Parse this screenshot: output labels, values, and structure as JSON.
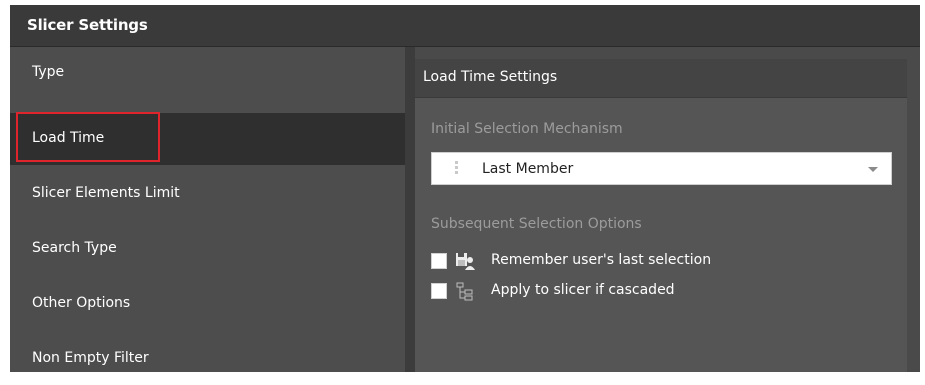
{
  "window": {
    "title": "Slicer Settings"
  },
  "sidebar": {
    "items": [
      {
        "label": "Type"
      },
      {
        "label": "Load Time"
      },
      {
        "label": "Slicer Elements Limit"
      },
      {
        "label": "Search Type"
      },
      {
        "label": "Other Options"
      },
      {
        "label": "Non Empty Filter"
      }
    ],
    "selected": "Load Time"
  },
  "panel": {
    "title": "Load Time Settings",
    "initial_section_label": "Initial Selection Mechanism",
    "dropdown_value": "Last Member",
    "subsequent_section_label": "Subsequent Selection Options",
    "options": [
      {
        "label": "Remember user's last selection",
        "icon": "save-user-icon",
        "checked": false
      },
      {
        "label": "Apply to slicer if cascaded",
        "icon": "hierarchy-icon",
        "checked": false
      }
    ]
  },
  "colors": {
    "highlight": "#e0242b",
    "selected_item": "#2f2f2f",
    "sidebar": "#4d4d4d",
    "panel": "#555555"
  }
}
